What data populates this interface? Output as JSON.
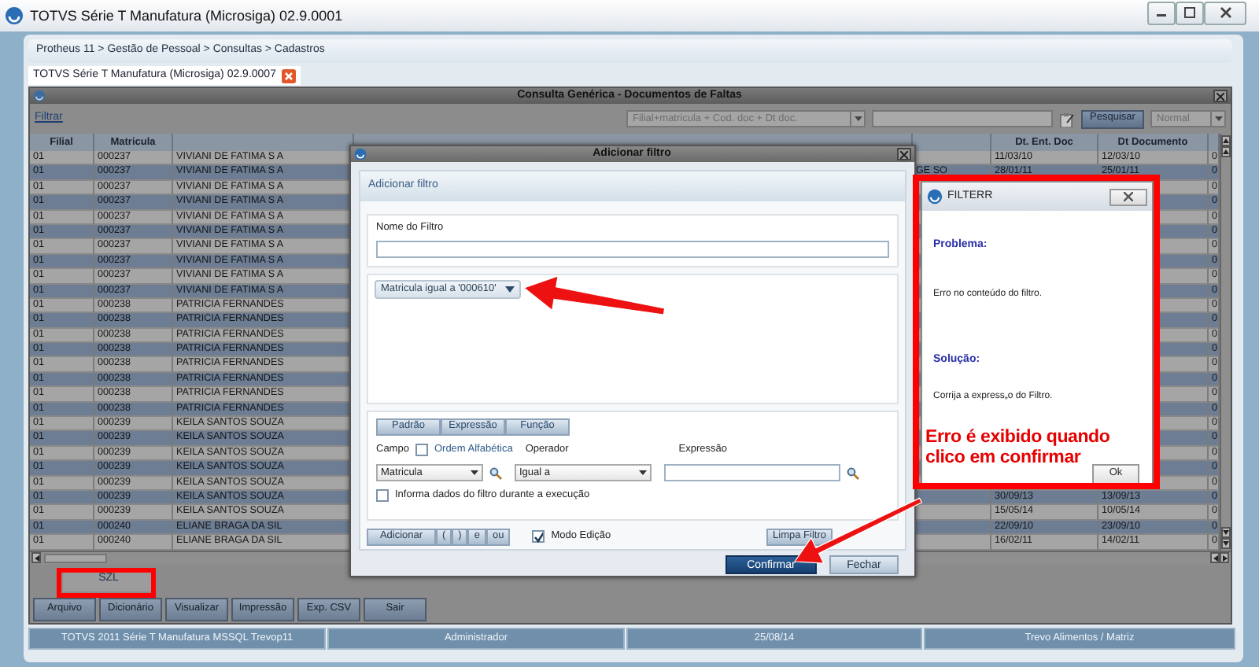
{
  "app_window": {
    "title": "TOTVS Série T Manufatura (Microsiga) 02.9.0001"
  },
  "breadcrumb": "Protheus 11 > Gestão de Pessoal > Consultas > Cadastros",
  "tabs": [
    {
      "label": "TOTVS Série T Manufatura (Microsiga) 02.9.0007",
      "selected": true
    }
  ],
  "query_window": {
    "title": "Consulta Genérica - Documentos de Faltas",
    "filter_link": "Filtrar",
    "index_select": "Filial+matricula + Cod. doc + Dt doc.",
    "search_button": "Pesquisar",
    "mode_select": "Normal",
    "table": {
      "columns": [
        "Filial",
        "Matricula",
        "Dt. Ent. Doc",
        "Dt Documento"
      ],
      "rows": [
        {
          "filial": "01",
          "matricula": "000237",
          "nome": "VIVIANI DE FATIMA S A",
          "dt_ent_doc": "11/03/10",
          "dt_documento": "12/03/10",
          "column_8": "0"
        },
        {
          "filial": "01",
          "matricula": "000237",
          "nome": "VIVIANI DE FATIMA S A",
          "desc_c_custo": "GE SO",
          "dt_ent_doc": "28/01/11",
          "dt_documento": "25/01/11",
          "column_8": "0"
        },
        {
          "filial": "01",
          "matricula": "000237",
          "nome": "VIVIANI DE FATIMA S A",
          "column_8": "0"
        },
        {
          "filial": "01",
          "matricula": "000237",
          "nome": "VIVIANI DE FATIMA S A",
          "column_8": "0"
        },
        {
          "filial": "01",
          "matricula": "000237",
          "nome": "VIVIANI DE FATIMA S A",
          "column_8": "0"
        },
        {
          "filial": "01",
          "matricula": "000237",
          "nome": "VIVIANI DE FATIMA S A",
          "column_8": "0"
        },
        {
          "filial": "01",
          "matricula": "000237",
          "nome": "VIVIANI DE FATIMA S A",
          "column_8": "0"
        },
        {
          "filial": "01",
          "matricula": "000237",
          "nome": "VIVIANI DE FATIMA S A",
          "column_8": "0"
        },
        {
          "filial": "01",
          "matricula": "000237",
          "nome": "VIVIANI DE FATIMA S A",
          "column_8": "0"
        },
        {
          "filial": "01",
          "matricula": "000237",
          "nome": "VIVIANI DE FATIMA S A",
          "column_8": "0"
        },
        {
          "filial": "01",
          "matricula": "000238",
          "nome": "PATRICIA FERNANDES",
          "column_8": "0"
        },
        {
          "filial": "01",
          "matricula": "000238",
          "nome": "PATRICIA FERNANDES",
          "column_8": "0"
        },
        {
          "filial": "01",
          "matricula": "000238",
          "nome": "PATRICIA FERNANDES",
          "column_8": "0"
        },
        {
          "filial": "01",
          "matricula": "000238",
          "nome": "PATRICIA FERNANDES",
          "column_8": "0"
        },
        {
          "filial": "01",
          "matricula": "000238",
          "nome": "PATRICIA FERNANDES",
          "column_8": "0"
        },
        {
          "filial": "01",
          "matricula": "000238",
          "nome": "PATRICIA FERNANDES",
          "column_8": "0"
        },
        {
          "filial": "01",
          "matricula": "000238",
          "nome": "PATRICIA FERNANDES",
          "column_8": "0"
        },
        {
          "filial": "01",
          "matricula": "000238",
          "nome": "PATRICIA FERNANDES",
          "column_8": "0"
        },
        {
          "filial": "01",
          "matricula": "000239",
          "nome": "KEILA SANTOS SOUZA",
          "column_8": "0"
        },
        {
          "filial": "01",
          "matricula": "000239",
          "nome": "KEILA SANTOS SOUZA",
          "column_8": "0"
        },
        {
          "filial": "01",
          "matricula": "000239",
          "nome": "KEILA SANTOS SOUZA",
          "column_8": "0"
        },
        {
          "filial": "01",
          "matricula": "000239",
          "nome": "KEILA SANTOS SOUZA",
          "column_8": "0"
        },
        {
          "filial": "01",
          "matricula": "000239",
          "nome": "KEILA SANTOS SOUZA",
          "column_8": "0"
        },
        {
          "filial": "01",
          "matricula": "000239",
          "nome": "KEILA SANTOS SOUZA",
          "dt_ent_doc": "30/09/13",
          "dt_documento": "13/09/13",
          "column_8": "0"
        },
        {
          "filial": "01",
          "matricula": "000239",
          "nome": "KEILA SANTOS SOUZA",
          "dt_ent_doc": "15/05/14",
          "dt_documento": "10/05/14",
          "column_8": "0"
        },
        {
          "filial": "01",
          "matricula": "000240",
          "nome": "ELIANE BRAGA DA SIL",
          "dt_ent_doc": "22/09/10",
          "dt_documento": "23/09/10",
          "column_8": "0"
        },
        {
          "filial": "01",
          "matricula": "000240",
          "nome": "ELIANE BRAGA DA SIL",
          "dt_ent_doc": "16/02/11",
          "dt_documento": "14/02/11",
          "column_8": "0"
        }
      ]
    },
    "bottom_tabs": [
      {
        "label": "SZL",
        "selected": true
      }
    ],
    "buttons": [
      "Arquivo",
      "Dicionário",
      "Visualizar",
      "Impressão",
      "Exp. CSV",
      "Sair"
    ]
  },
  "status_bar": [
    "TOTVS 2011 Série T Manufatura MSSQL Trevop11",
    "Administrador",
    "25/08/14",
    "Trevo Alimentos / Matriz"
  ],
  "filter_dialog": {
    "title": "Adicionar filtro",
    "heading": "Adicionar filtro",
    "name_label": "Nome do Filtro",
    "filter_chip": "Matricula igual a '000610'",
    "mode_tabs": [
      "Padrão",
      "Expressão",
      "Função"
    ],
    "field_label": "Campo",
    "alphabetical": {
      "label": "Ordem Alfabética",
      "checked": false
    },
    "operator_label": "Operador",
    "expression_label": "Expressão",
    "field_value": "Matricula",
    "operator_value": "Igual a",
    "ask_on_run": {
      "label": "Informa dados do filtro durante a execução",
      "checked": false
    },
    "logic_buttons": [
      "Adicionar",
      "(",
      ")",
      "e",
      "ou"
    ],
    "edit_mode": {
      "label": "Modo Edição",
      "checked": true
    },
    "clear_button": "Limpa Filtro",
    "confirm_button": "Confirmar",
    "close_button": "Fechar"
  },
  "error_dialog": {
    "title": "FILTERR",
    "problem_heading": "Problema:",
    "problem": "Erro no conteúdo do filtro.",
    "solution_heading": "Solução:",
    "solution": "Corrija a express„o do Filtro.",
    "ok_button": "Ok"
  },
  "annotation": {
    "text": "Erro é exibido quando clico em confirmar"
  }
}
